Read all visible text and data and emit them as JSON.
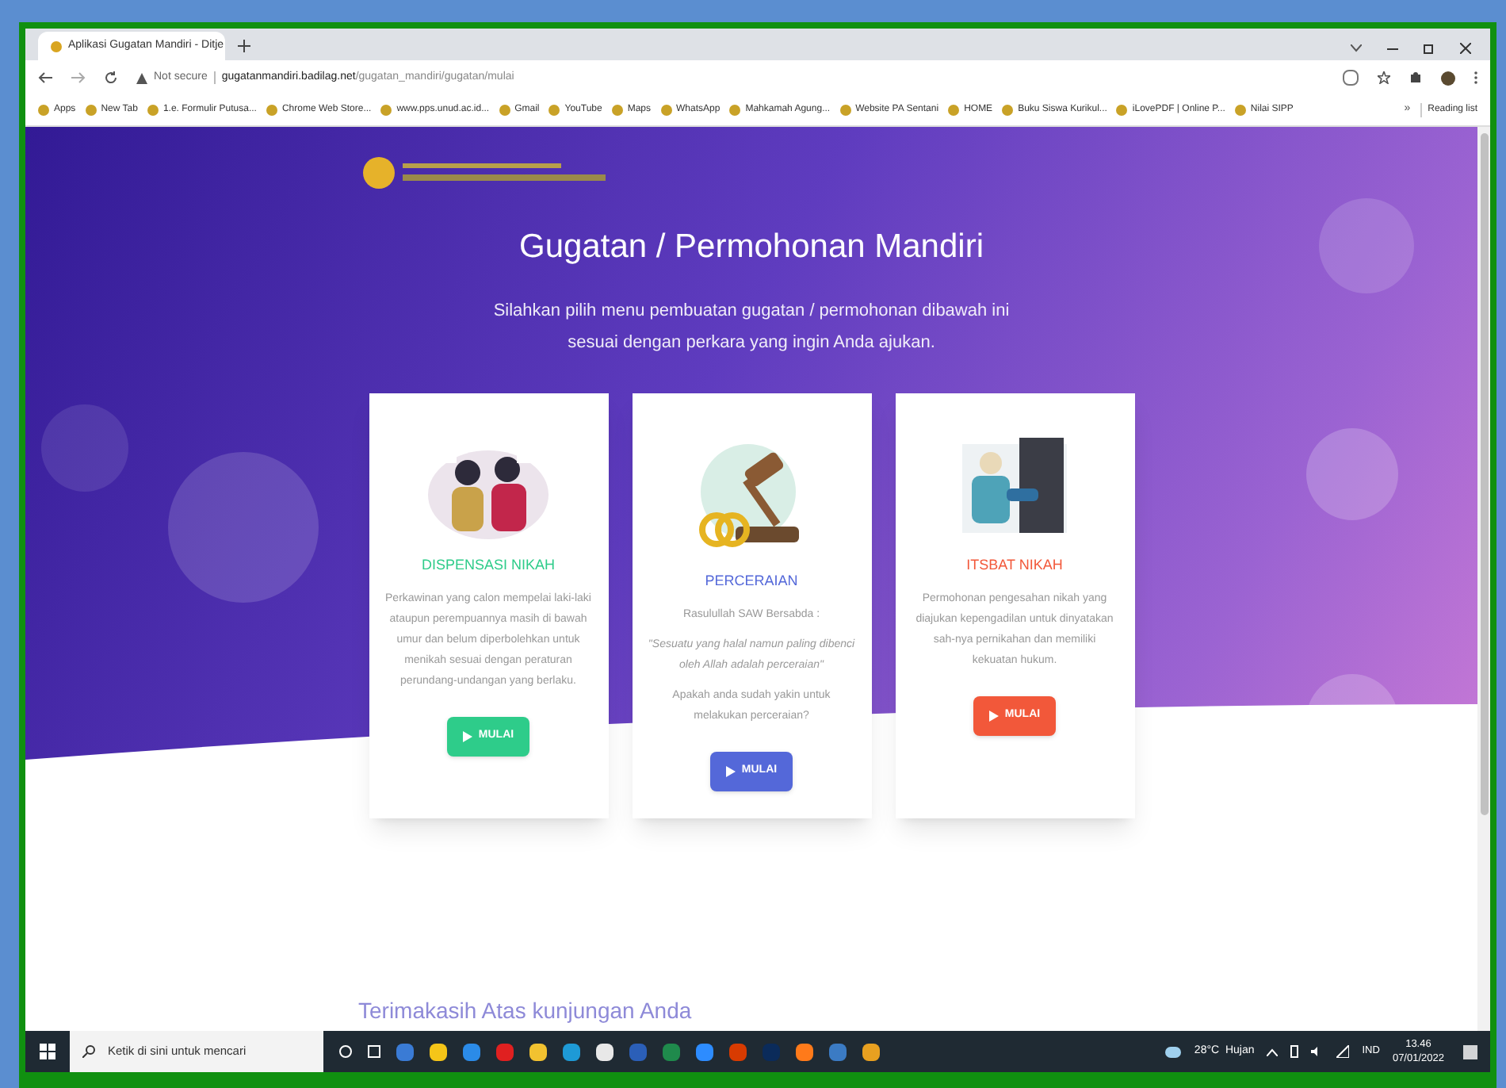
{
  "browser": {
    "tab": {
      "title": "Aplikasi Gugatan Mandiri - Ditje",
      "selected": true
    },
    "address": {
      "security": "Not secure",
      "domain": "gugatanmandiri.badilag.net",
      "path": "/gugatan_mandiri/gugatan/mulai"
    },
    "bookmarks": [
      "Apps",
      "New Tab",
      "1.e. Formulir Putusa...",
      "Chrome Web Store...",
      "www.pps.unud.ac.id...",
      "Gmail",
      "YouTube",
      "Maps",
      "WhatsApp",
      "Mahkamah Agung...",
      "Website PA Sentani",
      "HOME",
      "Buku Siswa Kurikul...",
      "iLovePDF | Online P...",
      "Nilai SIPP"
    ],
    "more": "»",
    "reading_list": "Reading list"
  },
  "page": {
    "title": "Gugatan / Permohonan Mandiri",
    "subtitle": [
      "Silahkan pilih menu pembuatan gugatan / permohonan dibawah ini",
      "sesuai dengan perkara yang ingin Anda ajukan."
    ],
    "cards": [
      {
        "kind": "children",
        "title": "DISPENSASI NIKAH",
        "color": "#2ecc8a",
        "paragraphs": [
          {
            "kind": "plain",
            "text": "Perkawinan yang calon mempelai laki-laki ataupun perempuannya masih di bawah umur dan belum diperbolehkan untuk menikah sesuai dengan peraturan perundang-undangan yang berlaku."
          }
        ],
        "button": "MULAI"
      },
      {
        "kind": "gavel",
        "title": "PERCERAIAN",
        "color": "#5468d9",
        "paragraphs": [
          {
            "kind": "plain",
            "text": "Rasulullah SAW Bersabda :"
          },
          {
            "kind": "quote",
            "text": "\"Sesuatu yang halal namun paling dibenci oleh Allah adalah perceraian\""
          },
          {
            "kind": "plain",
            "text": "Apakah anda sudah yakin untuk melakukan perceraian?"
          }
        ],
        "button": "MULAI"
      },
      {
        "kind": "couple",
        "title": "ITSBAT NIKAH",
        "color": "#f2583a",
        "paragraphs": [
          {
            "kind": "plain",
            "text": "Permohonan pengesahan nikah yang diajukan kepengadilan untuk dinyatakan sah-nya pernikahan dan memiliki kekuatan hukum."
          }
        ],
        "button": "MULAI"
      }
    ],
    "footer": "Terimakasih Atas kunjungan Anda"
  },
  "taskbar": {
    "search_placeholder": "Ketik di sini untuk mencari",
    "weather": "28°C  Hujan",
    "language": "IND",
    "time": "13.46",
    "date": "07/01/2022"
  }
}
